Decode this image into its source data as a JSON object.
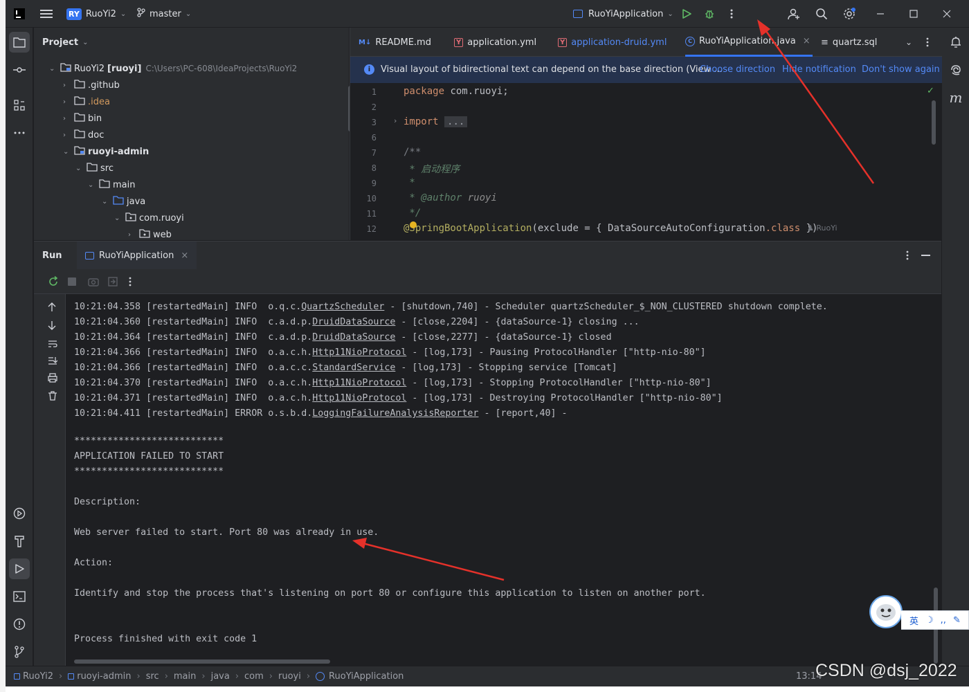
{
  "window": {
    "project_badge": "RY",
    "project_name": "RuoYi2",
    "branch": "master",
    "run_config": "RuoYiApplication"
  },
  "project_panel": {
    "title": "Project",
    "tree": [
      {
        "label": "RuoYi2",
        "suffix": "[ruoyi]",
        "path": "C:\\Users\\PC-608\\IdeaProjects\\RuoYi2"
      },
      {
        "label": ".github"
      },
      {
        "label": ".idea"
      },
      {
        "label": "bin"
      },
      {
        "label": "doc"
      },
      {
        "label": "ruoyi-admin"
      },
      {
        "label": "src"
      },
      {
        "label": "main"
      },
      {
        "label": "java"
      },
      {
        "label": "com.ruoyi"
      },
      {
        "label": "web"
      }
    ]
  },
  "editor": {
    "tabs": [
      {
        "label": "README.md",
        "icon": "M↓"
      },
      {
        "label": "application.yml",
        "icon": "Y"
      },
      {
        "label": "application-druid.yml",
        "icon": "Y"
      },
      {
        "label": "RuoYiApplication.java",
        "icon": "C"
      },
      {
        "label": "quartz.sql",
        "icon": "≡"
      }
    ],
    "notification": {
      "message": "Visual layout of bidirectional text can depend on the base direction (View ...",
      "choose": "Choose direction",
      "hide": "Hide notification",
      "dont_show": "Don't show again"
    },
    "line_numbers": [
      "1",
      "2",
      "3",
      "6",
      "7",
      "8",
      "9",
      "10",
      "11",
      "12"
    ],
    "code": {
      "package_kw": "package",
      "package_name": " com.ruoyi;",
      "import_kw": "import",
      "import_fold": "...",
      "doc_open": "/**",
      "doc_line1": " * 启动程序",
      "doc_star": " *",
      "doc_author_tag": " * @author",
      "doc_author": " ruoyi",
      "doc_close": " */",
      "annotation": "@SpringBootApplication",
      "annotation_args": "(exclude = { DataSourceAutoConfiguration",
      "class_kw": ".class",
      "annotation_end": " })",
      "author_hint": "RuoYi"
    }
  },
  "run_panel": {
    "title": "Run",
    "tab": "RuoYiApplication",
    "console": [
      {
        "t": "10:21:04.358",
        "th": "[restartedMain]",
        "lvl": "INFO ",
        "pkg": "o.q.c.",
        "cls": "QuartzScheduler",
        "msg": " - [shutdown,740] - Scheduler quartzScheduler_$_NON_CLUSTERED shutdown complete."
      },
      {
        "t": "10:21:04.360",
        "th": "[restartedMain]",
        "lvl": "INFO ",
        "pkg": "c.a.d.p.",
        "cls": "DruidDataSource",
        "msg": " - [close,2204] - {dataSource-1} closing ..."
      },
      {
        "t": "10:21:04.364",
        "th": "[restartedMain]",
        "lvl": "INFO ",
        "pkg": "c.a.d.p.",
        "cls": "DruidDataSource",
        "msg": " - [close,2277] - {dataSource-1} closed"
      },
      {
        "t": "10:21:04.366",
        "th": "[restartedMain]",
        "lvl": "INFO ",
        "pkg": "o.a.c.h.",
        "cls": "Http11NioProtocol",
        "msg": " - [log,173] - Pausing ProtocolHandler [\"http-nio-80\"]"
      },
      {
        "t": "10:21:04.366",
        "th": "[restartedMain]",
        "lvl": "INFO ",
        "pkg": "o.a.c.c.",
        "cls": "StandardService",
        "msg": " - [log,173] - Stopping service [Tomcat]"
      },
      {
        "t": "10:21:04.370",
        "th": "[restartedMain]",
        "lvl": "INFO ",
        "pkg": "o.a.c.h.",
        "cls": "Http11NioProtocol",
        "msg": " - [log,173] - Stopping ProtocolHandler [\"http-nio-80\"]"
      },
      {
        "t": "10:21:04.371",
        "th": "[restartedMain]",
        "lvl": "INFO ",
        "pkg": "o.a.c.h.",
        "cls": "Http11NioProtocol",
        "msg": " - [log,173] - Destroying ProtocolHandler [\"http-nio-80\"]"
      },
      {
        "t": "10:21:04.411",
        "th": "[restartedMain]",
        "lvl": "ERROR",
        "pkg": "o.s.b.d.",
        "cls": "LoggingFailureAnalysisReporter",
        "msg": " - [report,40] -"
      }
    ],
    "stars": "***************************",
    "failed": "APPLICATION FAILED TO START",
    "desc_label": "Description:",
    "desc_text": "Web server failed to start. Port 80 was already in use.",
    "action_label": "Action:",
    "action_text": "Identify and stop the process that's listening on port 80 or configure this application to listen on another port.",
    "exit_text": "Process finished with exit code 1"
  },
  "statusbar": {
    "crumbs": [
      "RuoYi2",
      "ruoyi-admin",
      "src",
      "main",
      "java",
      "com",
      "ruoyi",
      "RuoYiApplication"
    ],
    "time": "13:14"
  },
  "overlay": {
    "watermark": "CSDN @dsj_2022",
    "ime_label": "英"
  },
  "colors": {
    "accent": "#3574f0",
    "arrow": "#e5312a",
    "run_green": "#5fb865"
  }
}
